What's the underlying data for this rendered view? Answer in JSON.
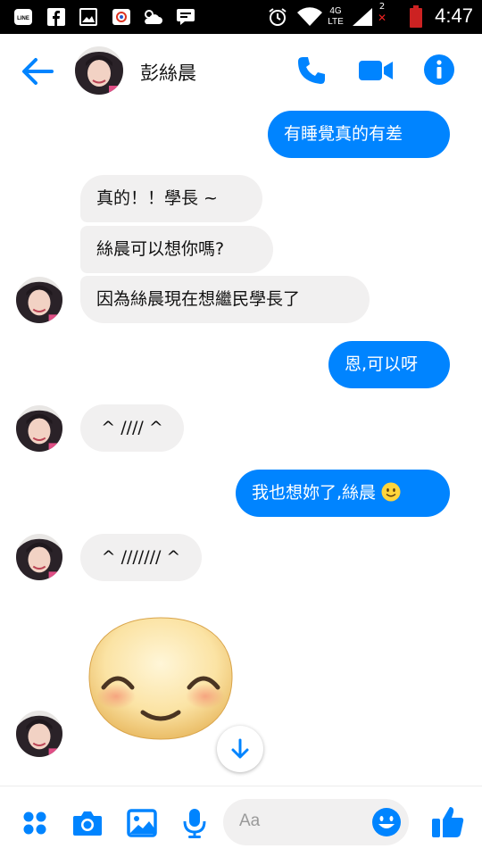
{
  "status_bar": {
    "time": "4:47",
    "network": "4G LTE",
    "sim_slot": "2",
    "app_icons": [
      "line-icon",
      "facebook-icon",
      "gallery-icon",
      "app-icon",
      "weather-icon",
      "message-icon"
    ]
  },
  "header": {
    "contact_name": "彭絲晨",
    "accent_color": "#0084ff"
  },
  "messages": [
    {
      "side": "out",
      "text": "有睡覺真的有差"
    },
    {
      "side": "in",
      "text": "真的！！學長 ~"
    },
    {
      "side": "in",
      "text": "絲晨可以想你嗎?"
    },
    {
      "side": "in",
      "text": "因為絲晨現在想繼民學長了"
    },
    {
      "side": "out",
      "text": "恩,可以呀"
    },
    {
      "side": "in",
      "text": "^ //// ^"
    },
    {
      "side": "out",
      "text": "我也想妳了,絲晨",
      "emoji": "smiling-face"
    },
    {
      "side": "in",
      "text": "^ /////// ^"
    },
    {
      "side": "in",
      "sticker": "blushing-smiley-sticker"
    }
  ],
  "composer": {
    "placeholder": "Aa",
    "icons": [
      "grid-icon",
      "camera-icon",
      "image-icon",
      "microphone-icon",
      "emoji-icon",
      "thumbs-up-icon"
    ]
  },
  "colors": {
    "outgoing_bubble": "#0084ff",
    "incoming_bubble": "#f1f0f0",
    "status_bar": "#000000"
  }
}
